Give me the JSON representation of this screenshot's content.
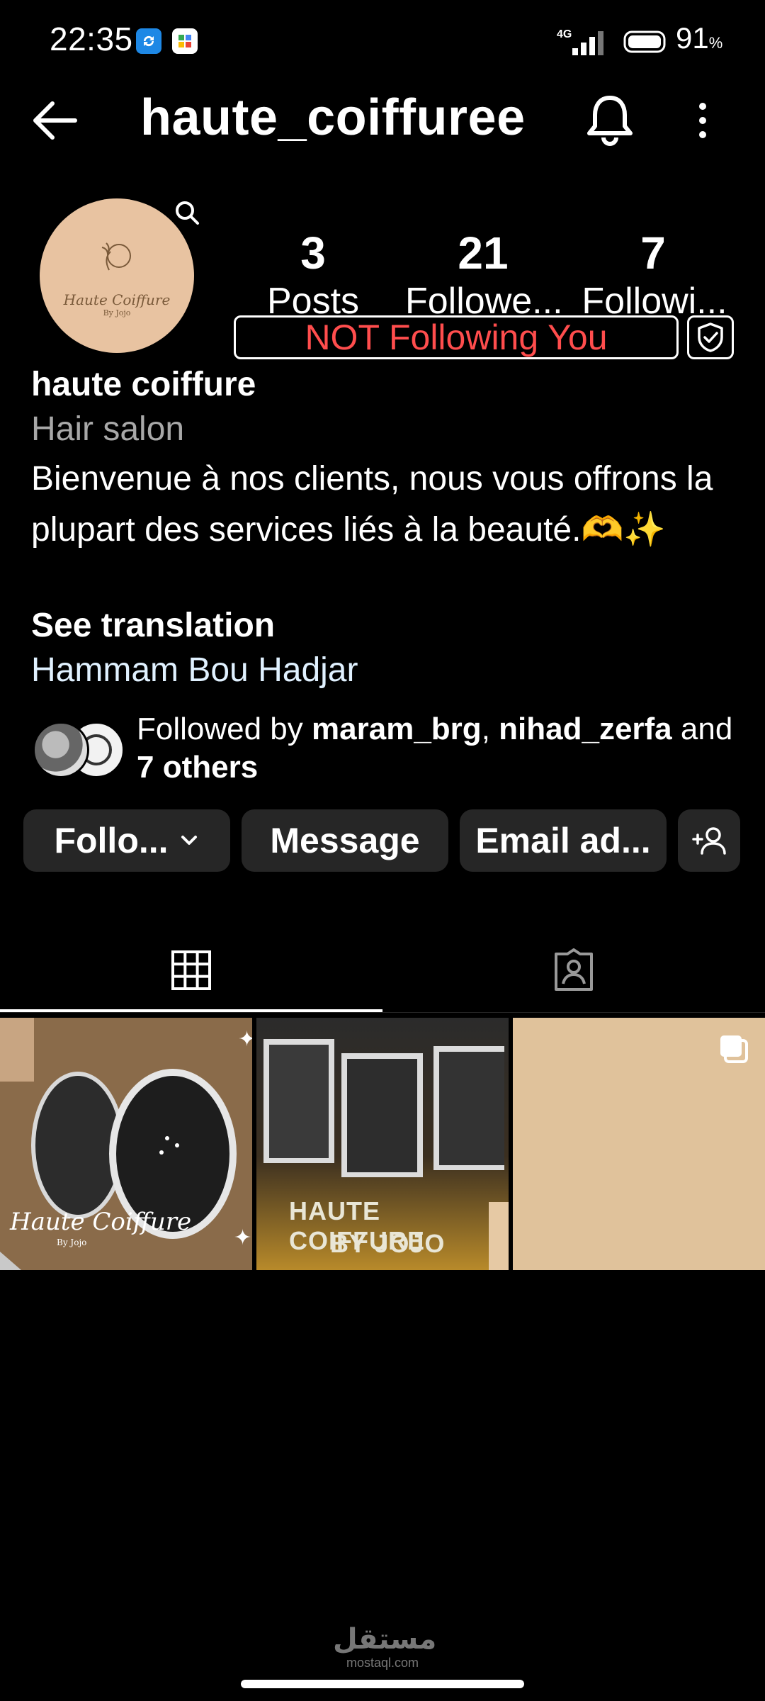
{
  "status_bar": {
    "time": "22:35",
    "network": "4G",
    "battery": "91",
    "battery_unit": "%"
  },
  "header": {
    "username": "haute_coiffuree"
  },
  "profile": {
    "avatar_logo_text": "Haute Coiffure",
    "avatar_logo_sub": "By Jojo",
    "stats": [
      {
        "value": "3",
        "label": "Posts"
      },
      {
        "value": "21",
        "label": "Followe..."
      },
      {
        "value": "7",
        "label": "Followi..."
      }
    ],
    "not_following_badge": "NOT Following You"
  },
  "bio": {
    "name": "haute coiffure",
    "category": "Hair salon",
    "text": "Bienvenue à nos clients, nous vous offrons la plupart des services liés à la beauté.🫶✨",
    "see_translation": "See translation",
    "location": "Hammam Bou Hadjar"
  },
  "followed_by": {
    "prefix": "Followed by ",
    "user1": "maram_brg",
    "separator": ", ",
    "user2": "nihad_zerfa",
    "conjunction": " and",
    "others": "7 others"
  },
  "actions": {
    "follow_label": "Follo...",
    "message_label": "Message",
    "email_label": "Email ad..."
  },
  "posts": [
    {
      "caption": "Haute Coiffure",
      "sub": "By Jojo"
    },
    {
      "caption": "HAUTE COIFFURE",
      "sub": "BY JOJO"
    },
    {
      "caption": "",
      "sub": ""
    }
  ],
  "watermark": {
    "arabic": "مستقل",
    "latin": "mostaql.com"
  },
  "colors": {
    "background": "#000000",
    "button_bg": "#262626",
    "badge_text": "#ff4d4d",
    "category_text": "#a8a8a8",
    "avatar_bg": "#e8c3a1"
  }
}
